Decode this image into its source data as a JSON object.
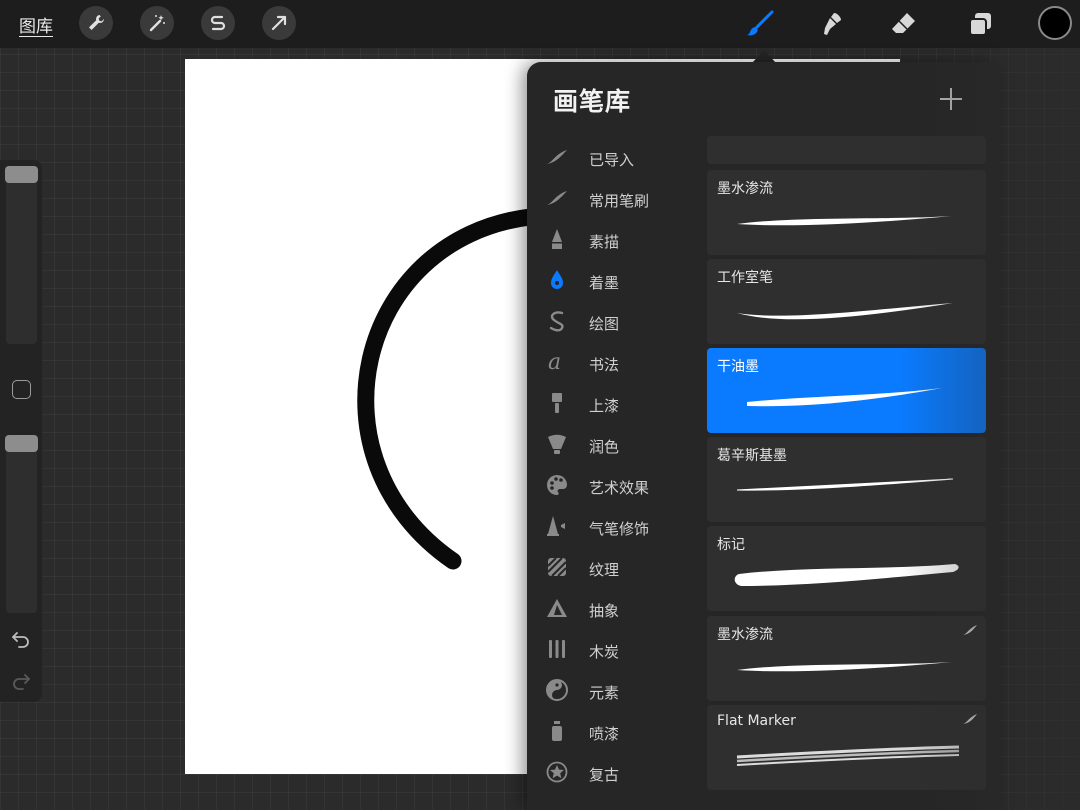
{
  "topbar": {
    "gallery_label": "图库",
    "tools_left": [
      "wrench-icon",
      "magic-wand-icon",
      "selection-s-icon",
      "transform-arrow-icon"
    ],
    "tools_right": [
      "brush-icon",
      "smudge-icon",
      "eraser-icon",
      "layers-icon"
    ],
    "active_tool": "brush",
    "active_color": "#000000",
    "accent_color": "#0a7bff"
  },
  "library": {
    "title": "画笔库",
    "categories": [
      {
        "label": "已导入",
        "icon": "imported-stroke-icon",
        "active": false
      },
      {
        "label": "常用笔刷",
        "icon": "common-stroke-icon",
        "active": false
      },
      {
        "label": "素描",
        "icon": "pencil-icon",
        "active": false
      },
      {
        "label": "着墨",
        "icon": "ink-pen-icon",
        "active": true
      },
      {
        "label": "绘图",
        "icon": "drawing-squiggle-icon",
        "active": false
      },
      {
        "label": "书法",
        "icon": "calligraphy-icon",
        "active": false
      },
      {
        "label": "上漆",
        "icon": "paint-brush-icon",
        "active": false
      },
      {
        "label": "润色",
        "icon": "blend-brush-icon",
        "active": false
      },
      {
        "label": "艺术效果",
        "icon": "palette-icon",
        "active": false
      },
      {
        "label": "气笔修饰",
        "icon": "airbrush-icon",
        "active": false
      },
      {
        "label": "纹理",
        "icon": "texture-icon",
        "active": false
      },
      {
        "label": "抽象",
        "icon": "abstract-triangle-icon",
        "active": false
      },
      {
        "label": "木炭",
        "icon": "charcoal-icon",
        "active": false
      },
      {
        "label": "元素",
        "icon": "elements-yinyang-icon",
        "active": false
      },
      {
        "label": "喷漆",
        "icon": "spray-can-icon",
        "active": false
      },
      {
        "label": "复古",
        "icon": "retro-star-icon",
        "active": false
      }
    ],
    "brushes": [
      {
        "name": "",
        "selected": false,
        "imported": false
      },
      {
        "name": "墨水渗流",
        "selected": false,
        "imported": false
      },
      {
        "name": "工作室笔",
        "selected": false,
        "imported": false
      },
      {
        "name": "干油墨",
        "selected": true,
        "imported": false
      },
      {
        "name": "葛辛斯基墨",
        "selected": false,
        "imported": false
      },
      {
        "name": "标记",
        "selected": false,
        "imported": false
      },
      {
        "name": "墨水渗流",
        "selected": false,
        "imported": true
      },
      {
        "name": "Flat Marker",
        "selected": false,
        "imported": true
      }
    ]
  }
}
